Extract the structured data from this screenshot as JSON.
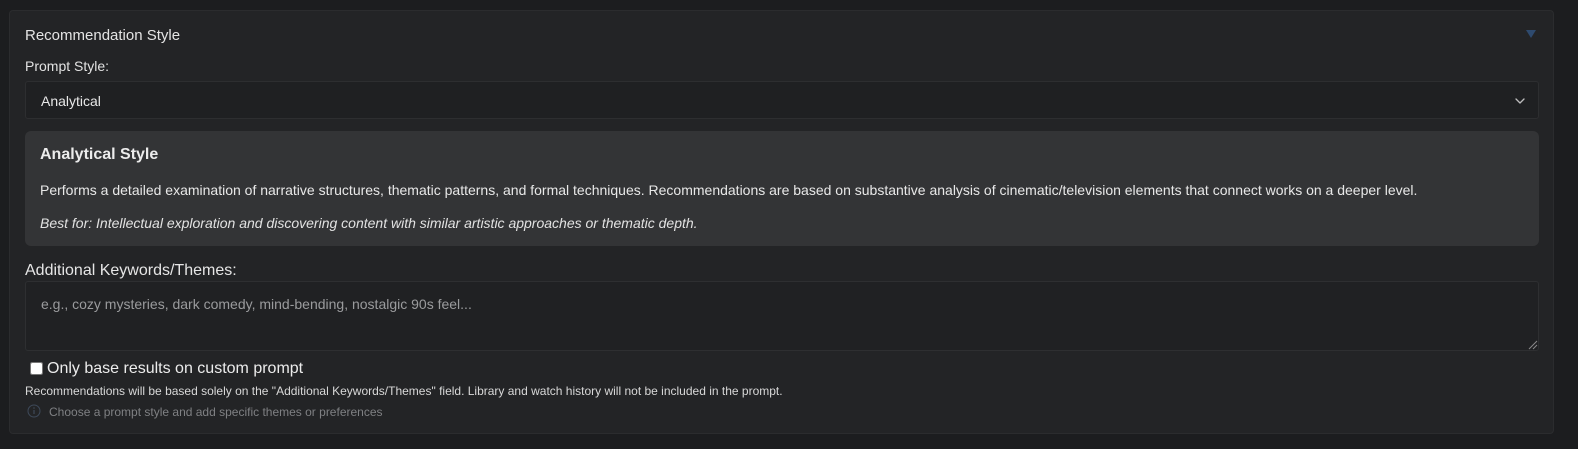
{
  "section": {
    "title": "Recommendation Style"
  },
  "prompt_style": {
    "label": "Prompt Style:",
    "selected": "Analytical"
  },
  "style_card": {
    "title": "Analytical Style",
    "description": "Performs a detailed examination of narrative structures, thematic patterns, and formal techniques. Recommendations are based on substantive analysis of cinematic/television elements that connect works on a deeper level.",
    "best_for": "Best for: Intellectual exploration and discovering content with similar artistic approaches or thematic depth."
  },
  "keywords": {
    "label": "Additional Keywords/Themes:",
    "placeholder": "e.g., cozy mysteries, dark comedy, mind-bending, nostalgic 90s feel...",
    "value": ""
  },
  "custom_prompt": {
    "label": "Only base results on custom prompt",
    "checked": false,
    "help": "Recommendations will be based solely on the \"Additional Keywords/Themes\" field. Library and watch history will not be included in the prompt."
  },
  "hint": {
    "text": "Choose a prompt style and add specific themes or preferences"
  },
  "colors": {
    "background": "#1c1d1f",
    "panel": "#232426",
    "card": "#333436",
    "collapse_icon": "#2e4a6e"
  },
  "icons": {
    "collapse": "triangle-down-icon",
    "select": "chevron-down-icon",
    "hint": "info-icon",
    "resize": "resize-handle-icon"
  }
}
